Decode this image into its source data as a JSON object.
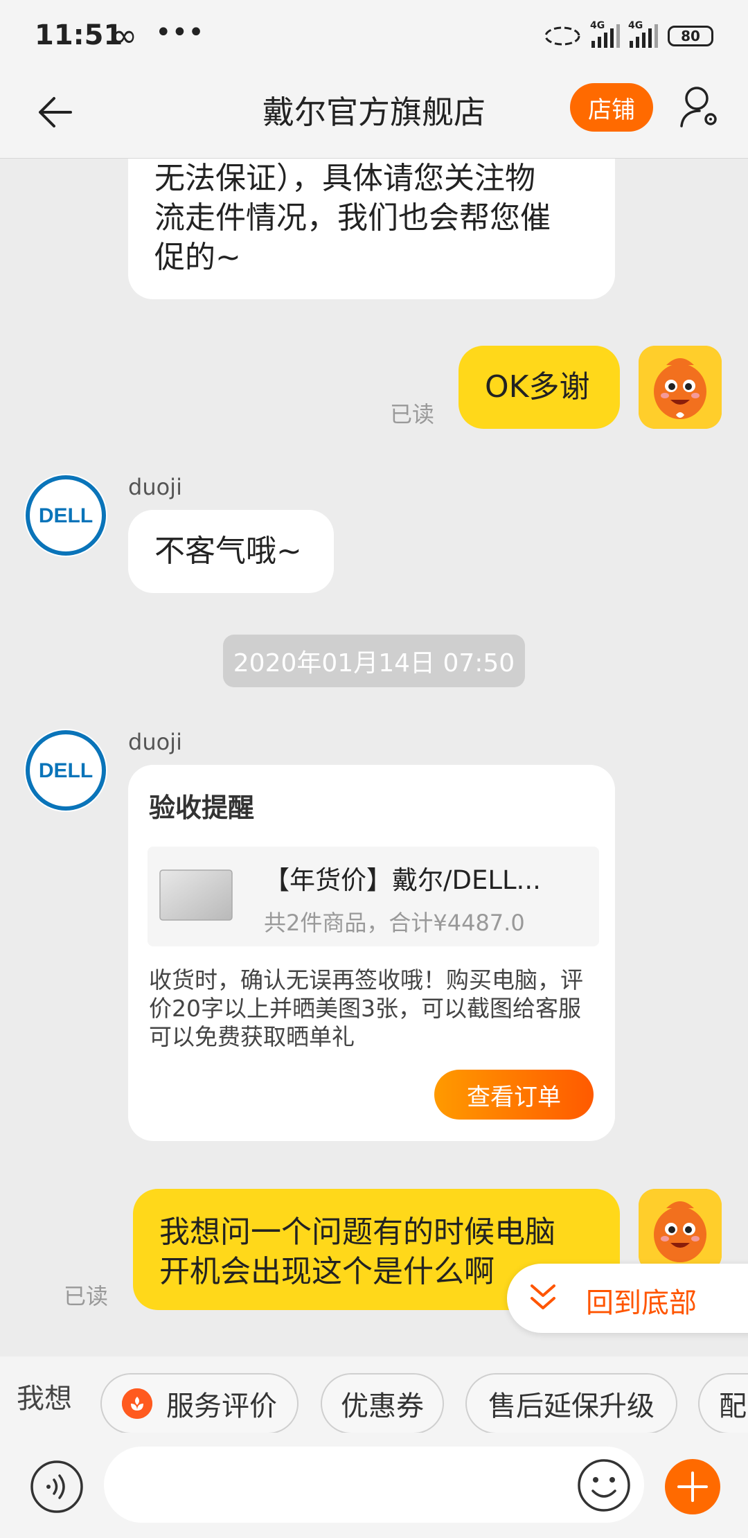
{
  "status_bar": {
    "time": "11:51",
    "loop": "∞",
    "dots": "•••",
    "net1": "4G",
    "net2": "4G",
    "battery": "80"
  },
  "header": {
    "back_icon": "back-arrow-icon",
    "title": "戴尔官方旗舰店",
    "shop_button": "店铺",
    "user_icon": "user-settings-icon"
  },
  "messages": {
    "m1": {
      "text_lines": [
        "无法保证），具体请您关注物",
        "流走件情况，我们也会帮您催",
        "促的~"
      ]
    },
    "m2": {
      "text": "OK多谢",
      "read": "已读"
    },
    "m3": {
      "sender": "duoji",
      "text": "不客气哦~"
    },
    "timestamp": "2020年01月14日 07:50",
    "m4": {
      "sender": "duoji",
      "title": "验收提醒",
      "product_name": "【年货价】戴尔/DELL...",
      "product_summary": "共2件商品，合计¥4487.0",
      "desc": "收货时，确认无误再签收哦！购买电脑，评价20字以上并晒美图3张，可以截图给客服可以免费获取晒单礼",
      "button": "查看订单"
    },
    "m5": {
      "text_lines": [
        "我想问一个问题有的时候电脑",
        "开机会出现这个是什么啊"
      ],
      "read": "已读"
    }
  },
  "avatar": {
    "dell_logo": "DELL"
  },
  "back_to_bottom": {
    "label": "回到底部",
    "icon": "double-chevron-down-icon"
  },
  "quick_bar": {
    "label": "我想",
    "chips": [
      "服务评价",
      "优惠券",
      "售后延保升级",
      "配"
    ]
  },
  "input_bar": {
    "placeholder": "",
    "voice_icon": "voice-icon",
    "emoji_icon": "emoji-icon",
    "plus_icon": "plus-icon"
  },
  "colors": {
    "accent": "#ff6a00",
    "own_bubble": "#ffd81a",
    "link": "#ff5500"
  }
}
